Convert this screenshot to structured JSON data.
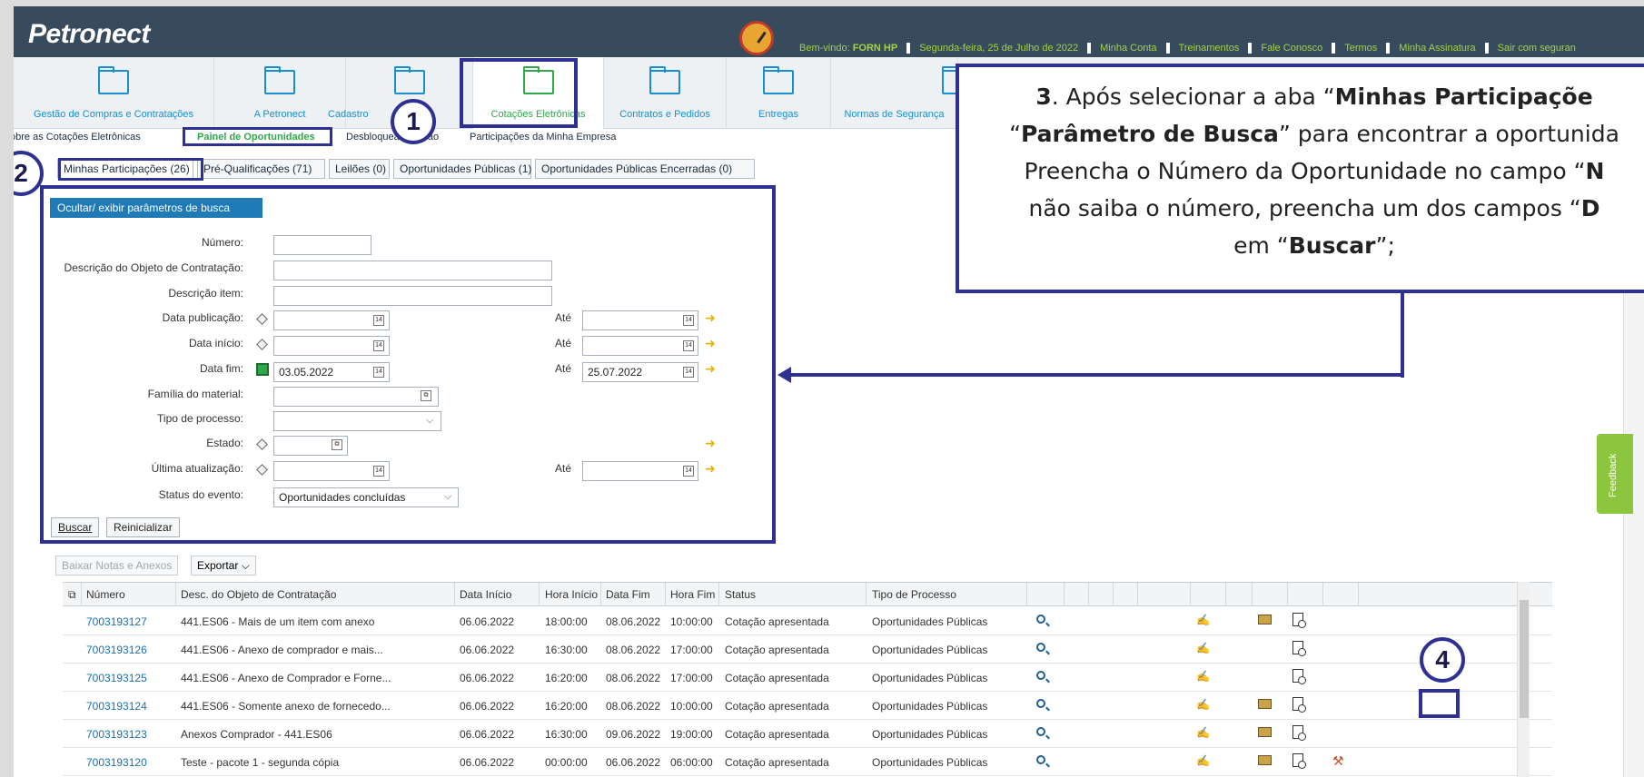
{
  "header": {
    "logo": "Petronect",
    "welcome_prefix": "Bem-vindo: ",
    "welcome_user": "FORN HP",
    "links": [
      "Segunda-feira, 25 de Julho de 2022",
      "Minha Conta",
      "Treinamentos",
      "Fale Conosco",
      "Termos",
      "Minha Assinatura",
      "Sair com seguran"
    ]
  },
  "tiles": [
    "Gestão de Compras e Contratações",
    "A Petronect",
    "Cadastro",
    "Cotações Eletrônicas",
    "Contratos e Pedidos",
    "Entregas",
    "Normas de Segurança"
  ],
  "subnav": [
    "obre as Cotações Eletrônicas",
    "Painel de Oportunidades",
    "Desbloquear Sessão",
    "Participações da Minha Empresa"
  ],
  "tabs": [
    "Minhas Participações (26)",
    "Pré-Qualificações (71)",
    "Leilões (0)",
    "Oportunidades Públicas (1)",
    "Oportunidades Públicas Encerradas (0)"
  ],
  "search": {
    "toggle_label": "Ocultar/ exibir parâmetros de busca",
    "labels": {
      "numero": "Número:",
      "descricao_objeto": "Descrição do Objeto de Contratação:",
      "descricao_item": "Descrição item:",
      "data_publicacao": "Data publicação:",
      "data_inicio": "Data início:",
      "data_fim": "Data fim:",
      "familia": "Família do material:",
      "tipo_processo": "Tipo de processo:",
      "estado": "Estado:",
      "ultima_atualizacao": "Última atualização:",
      "status_evento": "Status do evento:"
    },
    "ate": "Até",
    "data_fim_from": "03.05.2022",
    "data_fim_to": "25.07.2022",
    "status_evento_value": "Oportunidades concluídas",
    "buscar": "Buscar",
    "reinicializar": "Reinicializar",
    "calendar_glyph": "14"
  },
  "table_toolbar": {
    "baixar": "Baixar Notas e Anexos",
    "exportar": "Exportar"
  },
  "table": {
    "headers": [
      "Número",
      "Desc. do Objeto de Contratação",
      "Data Início",
      "Hora Início",
      "Data Fim",
      "Hora Fim",
      "Status",
      "Tipo de Processo"
    ],
    "rows": [
      [
        "7003193127",
        "441.ES06 - Mais de um item com anexo",
        "06.06.2022",
        "18:00:00",
        "08.06.2022",
        "10:00:00",
        "Cotação apresentada",
        "Oportunidades Públicas"
      ],
      [
        "7003193126",
        "441.ES06 - Anexo de comprador e mais...",
        "06.06.2022",
        "16:30:00",
        "08.06.2022",
        "17:00:00",
        "Cotação apresentada",
        "Oportunidades Públicas"
      ],
      [
        "7003193125",
        "441.ES06 - Anexo de Comprador e Forne...",
        "06.06.2022",
        "16:20:00",
        "08.06.2022",
        "17:00:00",
        "Cotação apresentada",
        "Oportunidades Públicas"
      ],
      [
        "7003193124",
        "441.ES06 - Somente anexo de fornecedo...",
        "06.06.2022",
        "16:20:00",
        "08.06.2022",
        "10:00:00",
        "Cotação apresentada",
        "Oportunidades Públicas"
      ],
      [
        "7003193123",
        "Anexos Comprador - 441.ES06",
        "06.06.2022",
        "16:30:00",
        "09.06.2022",
        "19:00:00",
        "Cotação apresentada",
        "Oportunidades Públicas"
      ],
      [
        "7003193120",
        "Teste - pacote 1 - segunda cópia",
        "06.06.2022",
        "00:00:00",
        "06.06.2022",
        "06:00:00",
        "Cotação apresentada",
        "Oportunidades Públicas"
      ]
    ]
  },
  "callout": {
    "num": "3",
    "l1_a": ". Após selecionar a aba “",
    "l1_b": "Minhas Participaçõe",
    "l2_q1": "“",
    "l2_b": "Parâmetro de Busca",
    "l2_a": "” para encontrar a oportunida",
    "l3_a": "Preencha o Número da Oportunidade no campo “",
    "l3_b": "N",
    "l4_a": "não saiba o número, preencha um dos campos “",
    "l4_b": "D",
    "l5_a": "em “",
    "l5_b": "Buscar",
    "l5_c": "”;"
  },
  "markers": [
    "1",
    "2",
    "4"
  ],
  "feedback": "Feedback",
  "colors": {
    "header_bg": "#374b5c",
    "accent_blue": "#1a8fd0",
    "accent_green": "#2ea84a",
    "annotation": "#2e3192"
  }
}
